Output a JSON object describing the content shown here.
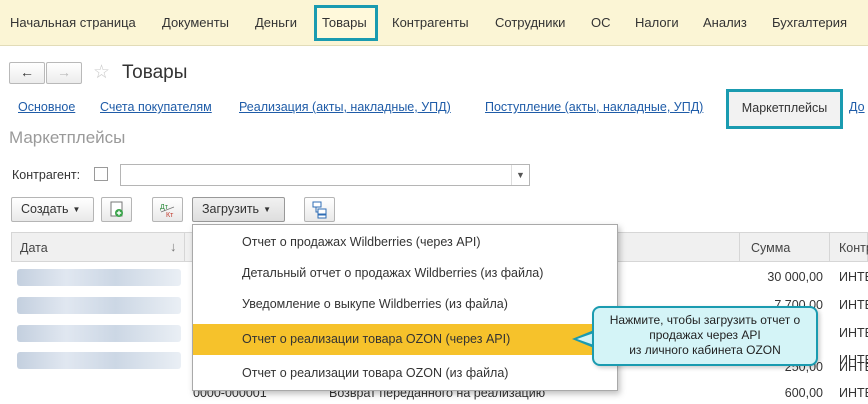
{
  "top_menu": {
    "items": [
      "Начальная страница",
      "Документы",
      "Деньги",
      "Товары",
      "Контрагенты",
      "Сотрудники",
      "ОС",
      "Налоги",
      "Анализ",
      "Бухгалтерия"
    ]
  },
  "nav": {
    "back": "←",
    "forward": "→"
  },
  "page_title": "Товары",
  "tabs": {
    "items": [
      "Основное",
      "Счета покупателям",
      "Реализация (акты, накладные, УПД)",
      "Поступление (акты, накладные, УПД)"
    ],
    "active": "Маркетплейсы",
    "overflow": "До"
  },
  "section_title": "Маркетплейсы",
  "filter": {
    "label": "Контрагент:",
    "value": ""
  },
  "toolbar": {
    "create": "Создать",
    "load": "Загрузить",
    "dtkt_top": "Дт",
    "dtkt_bottom": "Кт"
  },
  "table": {
    "columns": {
      "date": "Дата",
      "sum": "Сумма",
      "party": "Контр"
    },
    "rows": [
      {
        "num": "",
        "operation": "",
        "sum": "30 000,00",
        "party": "ИНТЕ"
      },
      {
        "num": "",
        "operation": "",
        "sum": "7 700,00",
        "party": "ИНТЕ"
      },
      {
        "num": "",
        "operation": "",
        "sum": "",
        "party": "ИНТЕ"
      },
      {
        "num": "",
        "operation": "",
        "sum": "",
        "party": "ИНТЕ"
      },
      {
        "num": "",
        "operation": "",
        "sum": "250,00",
        "party": "ИНТЕ"
      },
      {
        "num": "0000-000001",
        "operation": "Возврат переданного на реализацию",
        "sum": "600,00",
        "party": "ИНТЕ"
      }
    ]
  },
  "load_menu": {
    "items": [
      "Отчет о продажах Wildberries (через API)",
      "Детальный отчет о продажах Wildberries (из файла)",
      "Уведомление о выкупе Wildberries (из файла)",
      "Отчет о реализации товара OZON (через API)",
      "Отчет о реализации товара OZON (из файла)"
    ],
    "highlighted_index": 3
  },
  "tooltip": {
    "line1": "Нажмите, чтобы загрузить отчет о",
    "line2": "продажах через API",
    "line3": "из личного кабинета OZON"
  },
  "colors": {
    "accent": "#1a9bb0",
    "highlight": "#f6c22b",
    "menu_bg": "#fbf5d5",
    "link": "#1f5ca8"
  }
}
